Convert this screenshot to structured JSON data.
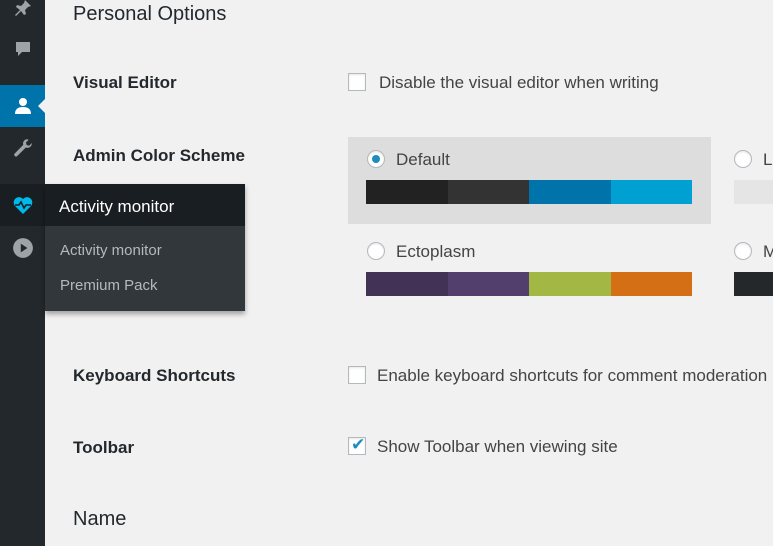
{
  "sidebar": {
    "icons": [
      {
        "name": "pin-icon"
      },
      {
        "name": "comments-icon"
      },
      {
        "name": "users-icon"
      },
      {
        "name": "tools-icon"
      },
      {
        "name": "heartbeat-icon"
      },
      {
        "name": "play-icon"
      }
    ]
  },
  "flyout": {
    "title": "Activity monitor",
    "items": [
      "Activity monitor",
      "Premium Pack"
    ]
  },
  "main": {
    "section_title": "Personal Options",
    "visual_editor": {
      "label": "Visual Editor",
      "checkbox_label": "Disable the visual editor when writing",
      "checked": false
    },
    "color_scheme": {
      "label": "Admin Color Scheme",
      "options": [
        {
          "name": "Default",
          "selected": true,
          "colors": [
            "#222222",
            "#333333",
            "#0073aa",
            "#00a0d2"
          ]
        },
        {
          "name": "L",
          "selected": false,
          "colors": [
            "#e5e5e5"
          ]
        },
        {
          "name": "Ectoplasm",
          "selected": false,
          "colors": [
            "#413256",
            "#523f6d",
            "#a3b745",
            "#d46f15"
          ]
        },
        {
          "name": "M",
          "selected": false,
          "colors": [
            "#25282b"
          ]
        }
      ]
    },
    "keyboard_shortcuts": {
      "label": "Keyboard Shortcuts",
      "checkbox_label": "Enable keyboard shortcuts for comment moderation",
      "checked": false
    },
    "toolbar": {
      "label": "Toolbar",
      "checkbox_label": "Show Toolbar when viewing site",
      "checked": true
    },
    "name_section_title": "Name"
  },
  "colors": {
    "accent": "#0073aa",
    "sidebar_bg": "#23282d",
    "flyout_bg": "#32373c",
    "page_bg": "#f1f1f1",
    "highlight_icon": "#00b9eb"
  }
}
